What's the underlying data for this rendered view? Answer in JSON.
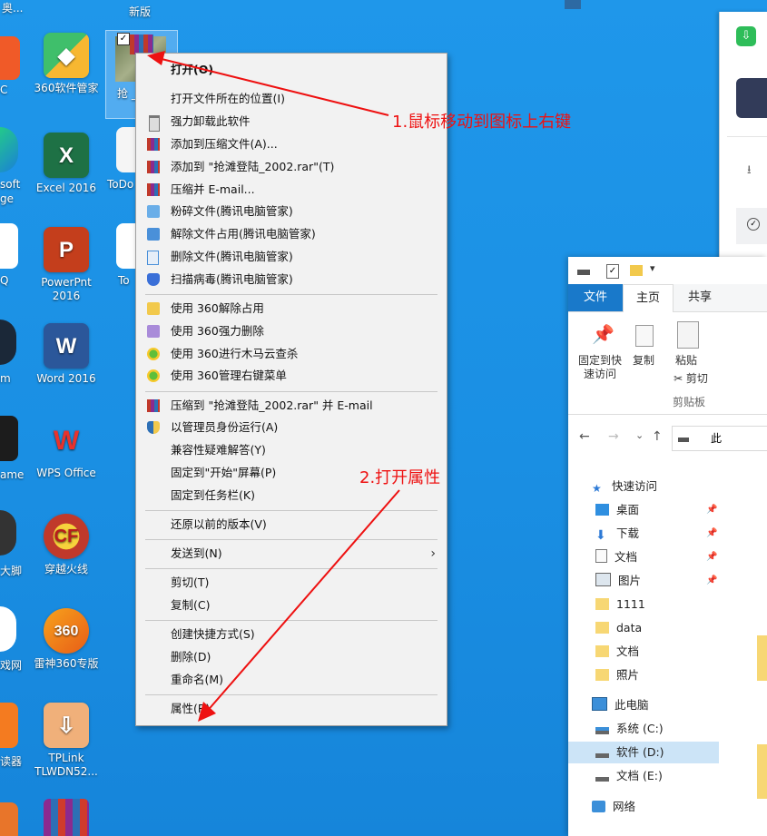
{
  "desktop": {
    "top_partial": [
      "奥...",
      "新版"
    ],
    "icons": [
      {
        "label": "360软件管家"
      },
      {
        "label": "Excel 2016"
      },
      {
        "label": "PowerPnt 2016"
      },
      {
        "label": "Word 2016"
      },
      {
        "label": "WPS Office"
      },
      {
        "label": "穿越火线"
      },
      {
        "label": "雷神360专版"
      },
      {
        "label": "TPLink TLWDN52..."
      }
    ],
    "left_partials": [
      "C",
      "soft",
      "ge",
      "Q",
      "m",
      "ame",
      "大脚",
      "戏网",
      "读器"
    ],
    "todo_partial": "ToDo",
    "to_partial": "To",
    "selected_icon_label": "抢 _2"
  },
  "context_menu": {
    "items": [
      {
        "label": "打开(O)",
        "bold": true
      },
      {
        "label": "打开文件所在的位置(I)"
      },
      {
        "label": "强力卸载此软件"
      },
      {
        "label": "添加到压缩文件(A)..."
      },
      {
        "label": "添加到 \"抢滩登陆_2002.rar\"(T)"
      },
      {
        "label": "压缩并 E-mail..."
      },
      {
        "label": "粉碎文件(腾讯电脑管家)"
      },
      {
        "label": "解除文件占用(腾讯电脑管家)"
      },
      {
        "label": "删除文件(腾讯电脑管家)"
      },
      {
        "label": "扫描病毒(腾讯电脑管家)"
      },
      {
        "label": "使用 360解除占用"
      },
      {
        "label": "使用 360强力删除"
      },
      {
        "label": "使用 360进行木马云查杀"
      },
      {
        "label": "使用 360管理右键菜单"
      },
      {
        "label": "压缩到 \"抢滩登陆_2002.rar\" 并 E-mail"
      },
      {
        "label": "以管理员身份运行(A)"
      },
      {
        "label": "兼容性疑难解答(Y)"
      },
      {
        "label": "固定到\"开始\"屏幕(P)"
      },
      {
        "label": "固定到任务栏(K)"
      },
      {
        "label": "还原以前的版本(V)"
      },
      {
        "label": "发送到(N)"
      },
      {
        "label": "剪切(T)"
      },
      {
        "label": "复制(C)"
      },
      {
        "label": "创建快捷方式(S)"
      },
      {
        "label": "删除(D)"
      },
      {
        "label": "重命名(M)"
      },
      {
        "label": "属性(R)"
      }
    ]
  },
  "annotations": {
    "step1": "1.鼠标移动到图标上右键",
    "step2": "2.打开属性",
    "color": "#ee1111"
  },
  "explorer": {
    "tabs": {
      "file": "文件",
      "home": "主页",
      "share": "共享"
    },
    "ribbon": {
      "pin": "固定到快速访问",
      "copy": "复制",
      "paste": "粘贴",
      "cut": "✂ 剪切",
      "group": "剪贴板"
    },
    "address_partial": "此",
    "nav": {
      "quick_access": "快速访问",
      "desktop": "桌面",
      "downloads": "下载",
      "documents": "文档",
      "pictures": "图片",
      "f1111": "1111",
      "data": "data",
      "doc2": "文档",
      "photos": "照片",
      "this_pc": "此电脑",
      "c": "系统 (C:)",
      "d": "软件 (D:)",
      "e": "文档 (E:)",
      "network": "网络"
    }
  },
  "colors": {
    "accent": "#1979ca",
    "desktop": "#1a8fe3"
  }
}
